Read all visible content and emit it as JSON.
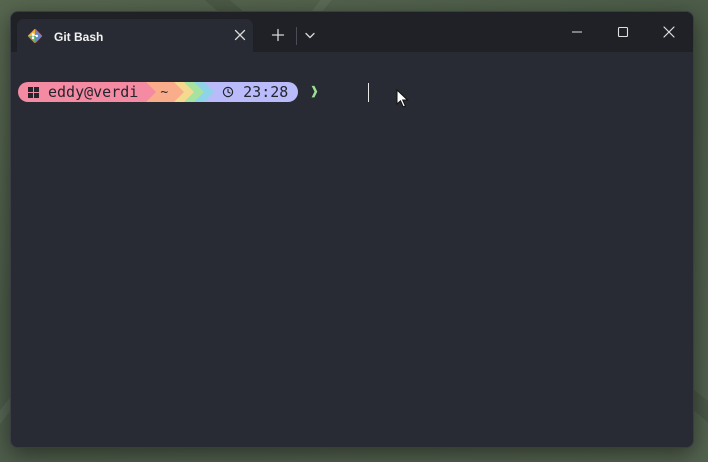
{
  "window": {
    "tab_title": "Git Bash",
    "tab_icon": "git-icon",
    "new_tab_icon": "plus-icon",
    "dropdown_icon": "chevron-down-icon",
    "controls": [
      "minimize-icon",
      "maximize-icon",
      "close-icon"
    ]
  },
  "terminal": {
    "prompt": {
      "os_icon": "windows-logo-icon",
      "user_host": "eddy@verdi",
      "path": "~",
      "time_icon": "clock-icon",
      "time": "23:28",
      "prompt_symbol": "❱"
    }
  },
  "colors": {
    "user_segment": "#f58aa3",
    "path_segment": "#f9ad8a",
    "time_segment": "#b9bbfb",
    "prompt_symbol": "#9dde97",
    "terminal_bg": "#282b33",
    "titlebar_bg": "#1f2127"
  }
}
